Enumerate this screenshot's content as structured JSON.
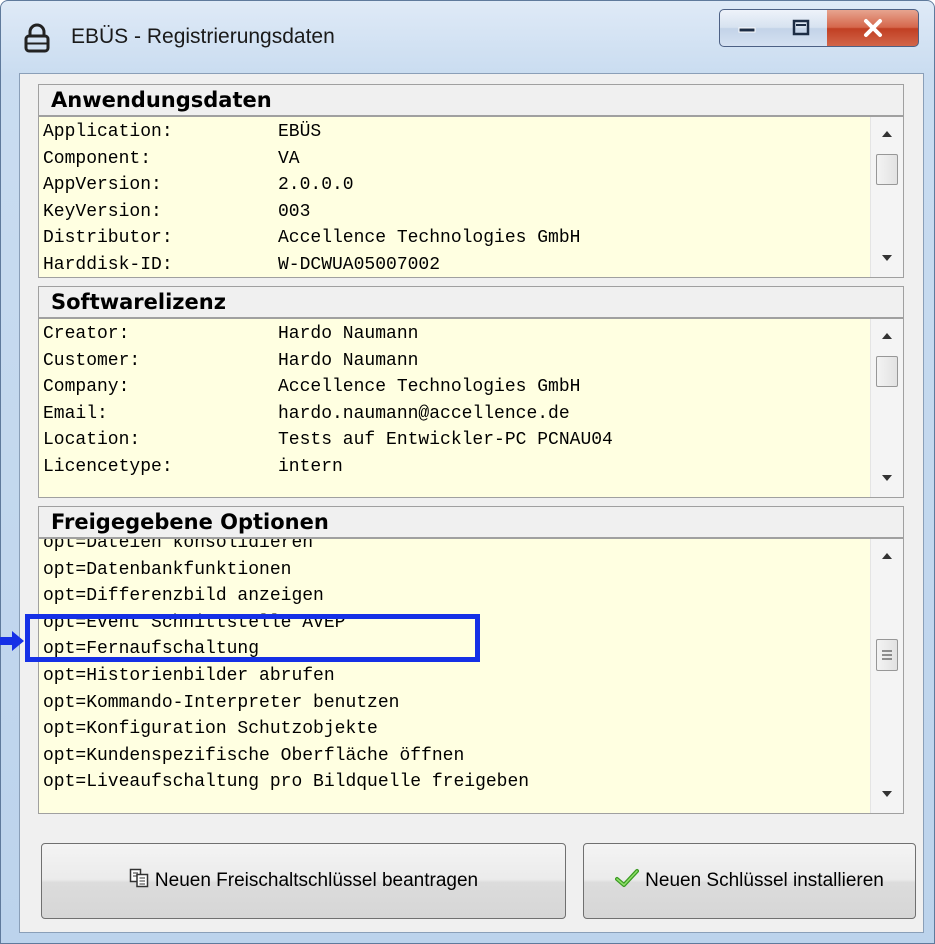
{
  "window": {
    "title": "EBÜS - Registrierungsdaten",
    "icon": "padlock-icon",
    "controls": [
      "minimize-icon",
      "maximize-icon",
      "close-icon"
    ]
  },
  "sections": [
    {
      "title": "Anwendungsdaten",
      "rows": [
        {
          "key": "Application:",
          "value": "EBÜS"
        },
        {
          "key": "Component:",
          "value": "VA"
        },
        {
          "key": "AppVersion:",
          "value": "2.0.0.0"
        },
        {
          "key": "KeyVersion:",
          "value": "003"
        },
        {
          "key": "Distributor:",
          "value": "Accellence Technologies GmbH"
        },
        {
          "key": "Harddisk-ID:",
          "value": "W-DCWUA05007002"
        }
      ]
    },
    {
      "title": "Softwarelizenz",
      "rows": [
        {
          "key": "Creator:",
          "value": "Hardo Naumann"
        },
        {
          "key": "Customer:",
          "value": "Hardo Naumann"
        },
        {
          "key": "Company:",
          "value": "Accellence Technologies GmbH"
        },
        {
          "key": "Email:",
          "value": "hardo.naumann@accellence.de"
        },
        {
          "key": "Location:",
          "value": "Tests auf Entwickler-PC PCNAU04"
        },
        {
          "key": "Licencetype:",
          "value": "intern"
        }
      ]
    },
    {
      "title": "Freigegebene Optionen",
      "options": [
        "opt=Dateien konsolidieren",
        "opt=Datenbankfunktionen",
        "opt=Differenzbild anzeigen",
        "opt=Event Schnittstelle AVEP",
        "opt=Fernaufschaltung",
        "opt=Historienbilder abrufen",
        "opt=Kommando-Interpreter benutzen",
        "opt=Konfiguration Schutzobjekte",
        "opt=Kundenspezifische Oberfläche öffnen",
        "opt=Liveaufschaltung pro Bildquelle freigeben"
      ]
    }
  ],
  "buttons": {
    "request_key": {
      "label": "Neuen Freischaltschlüssel beantragen",
      "icon": "copy-document-icon"
    },
    "install_key": {
      "label": "Neuen Schlüssel installieren",
      "icon": "checkmark-icon"
    }
  },
  "annotation": {
    "color": "#1530e6",
    "highlighted_option": "opt=Event Schnittstelle AVEP"
  }
}
